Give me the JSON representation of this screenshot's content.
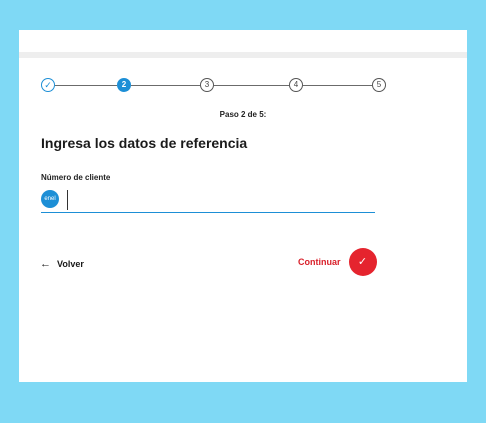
{
  "stepper": {
    "steps": [
      {
        "label": "✓",
        "state": "done"
      },
      {
        "label": "2",
        "state": "current"
      },
      {
        "label": "3",
        "state": "upcoming"
      },
      {
        "label": "4",
        "state": "upcoming"
      },
      {
        "label": "5",
        "state": "upcoming"
      }
    ],
    "caption": "Paso 2 de 5:"
  },
  "form": {
    "title": "Ingresa los datos de referencia",
    "field_label": "Número de cliente",
    "brand_badge": "enel",
    "input_value": ""
  },
  "actions": {
    "back_icon": "arrow-left-icon",
    "back_arrow": "←",
    "back_label": "Volver",
    "continue_label": "Continuar",
    "continue_icon": "checkmark-icon",
    "continue_glyph": "✓"
  },
  "colors": {
    "background": "#7fd9f5",
    "accent_blue": "#1d8fd6",
    "accent_red": "#e5242e"
  }
}
